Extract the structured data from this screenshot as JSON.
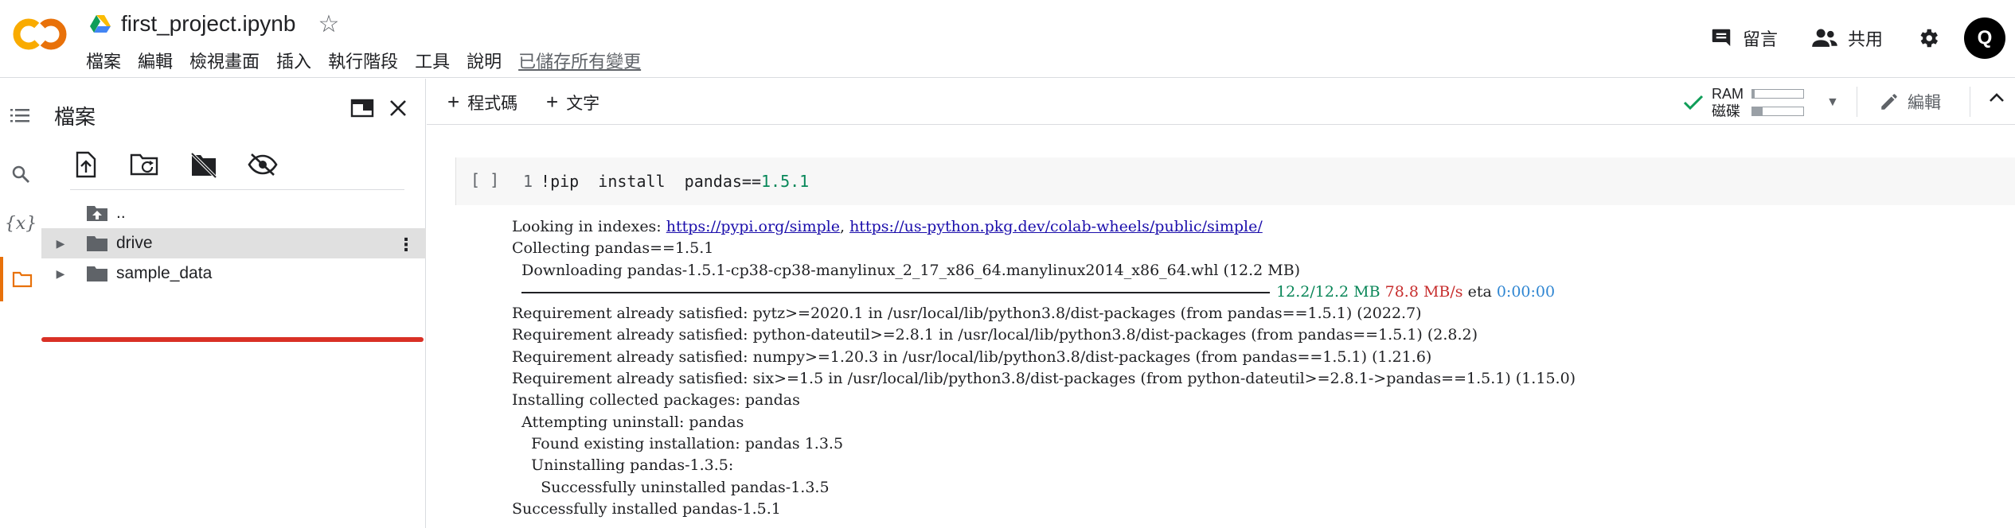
{
  "header": {
    "notebook_title": "first_project.ipynb",
    "menu": [
      "檔案",
      "編輯",
      "檢視畫面",
      "插入",
      "執行階段",
      "工具",
      "說明"
    ],
    "saved_status": "已儲存所有變更",
    "comment_label": "留言",
    "share_label": "共用",
    "avatar_letter": "Q"
  },
  "files_panel": {
    "title": "檔案",
    "tree": [
      {
        "label": "..",
        "type": "parent"
      },
      {
        "label": "drive",
        "type": "folder",
        "selected": true
      },
      {
        "label": "sample_data",
        "type": "folder",
        "selected": false
      }
    ]
  },
  "notebook_toolbar": {
    "add_code_label": "程式碼",
    "add_text_label": "文字",
    "ram_label": "RAM",
    "disk_label": "磁碟",
    "ram_usage": 0.05,
    "disk_usage": 0.2,
    "edit_label": "編輯"
  },
  "cell": {
    "run_indicator": "[ ]",
    "line_number": "1",
    "code_prefix": "!pip  install  pandas==",
    "code_version": "1.5.1"
  },
  "output": {
    "looking_prefix": "Looking in indexes: ",
    "index_url_1": "https://pypi.org/simple",
    "index_sep": ", ",
    "index_url_2": "https://us-python.pkg.dev/colab-wheels/public/simple/",
    "collecting": "Collecting pandas==1.5.1",
    "downloading": "  Downloading pandas-1.5.1-cp38-cp38-manylinux_2_17_x86_64.manylinux2014_x86_64.whl (12.2 MB)",
    "progress_size": "12.2/12.2 MB",
    "progress_speed": "78.8 MB/s",
    "progress_eta_label": "eta",
    "progress_eta": "0:00:00",
    "req_pytz": "Requirement already satisfied: pytz>=2020.1 in /usr/local/lib/python3.8/dist-packages (from pandas==1.5.1) (2022.7)",
    "req_dateutil": "Requirement already satisfied: python-dateutil>=2.8.1 in /usr/local/lib/python3.8/dist-packages (from pandas==1.5.1) (2.8.2)",
    "req_numpy": "Requirement already satisfied: numpy>=1.20.3 in /usr/local/lib/python3.8/dist-packages (from pandas==1.5.1) (1.21.6)",
    "req_six": "Requirement already satisfied: six>=1.5 in /usr/local/lib/python3.8/dist-packages (from python-dateutil>=2.8.1->pandas==1.5.1) (1.15.0)",
    "installing": "Installing collected packages: pandas",
    "attempting": "  Attempting uninstall: pandas",
    "found": "    Found existing installation: pandas 1.3.5",
    "uninstalling": "    Uninstalling pandas-1.3.5:",
    "uninstalled": "      Successfully uninstalled pandas-1.3.5",
    "installed": "Successfully installed pandas-1.5.1"
  },
  "colors": {
    "accent_orange": "#e8710a",
    "logo_yellow": "#f9ab00",
    "highlight_red": "#d93025",
    "progress_green": "#098658",
    "progress_red": "#c72e2e",
    "progress_cyan": "#2f86d2"
  },
  "icons": {
    "rail": [
      "toc-icon",
      "search-icon",
      "variables-icon",
      "folder-icon"
    ],
    "file_toolbar": [
      "upload-file-icon",
      "refresh-folder-icon",
      "unmount-drive-icon",
      "hide-icon"
    ]
  }
}
